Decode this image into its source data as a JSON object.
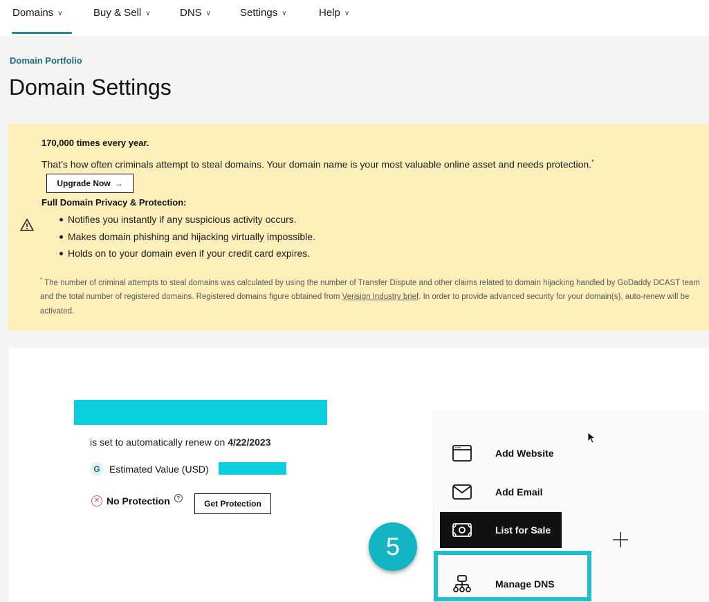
{
  "nav": {
    "items": [
      {
        "label": "Domains"
      },
      {
        "label": "Buy & Sell"
      },
      {
        "label": "DNS"
      },
      {
        "label": "Settings"
      },
      {
        "label": "Help"
      }
    ]
  },
  "breadcrumb": "Domain Portfolio",
  "page_title": "Domain Settings",
  "banner": {
    "headline": "170,000 times every year.",
    "body": "That’s how often criminals attempt to steal domains. Your domain name is your most valuable online asset and needs protection.",
    "body_mark": "*",
    "upgrade_label": "Upgrade Now",
    "features_title": "Full Domain Privacy & Protection:",
    "features": [
      "Notifies you instantly if any suspicious activity occurs.",
      "Makes domain phishing and hijacking virtually impossible.",
      "Holds on to your domain even if your credit card expires."
    ],
    "footnote_mark": "*",
    "footnote_pre": " The number of criminal attempts to steal domains was calculated by using the number of Transfer Dispute and other claims related to domain hijacking handled by GoDaddy DCAST team and the total number of registered domains. Registered domains figure obtained from ",
    "footnote_link": "Verisign Industry brief",
    "footnote_post": ". In order to provide advanced security for your domain(s), auto-renew will be activated."
  },
  "domain": {
    "renew_prefix": "is set to automatically renew on ",
    "renew_date": "4/22/2023",
    "value_badge": "G",
    "estimated_value_label": "Estimated Value (USD)",
    "protection_status": "No Protection",
    "get_protection_label": "Get Protection"
  },
  "actions": [
    {
      "label": "Add Website",
      "icon": "browser-window-icon"
    },
    {
      "label": "Add Email",
      "icon": "envelope-icon"
    },
    {
      "label": "List for Sale",
      "icon": "cash-icon"
    },
    {
      "label": "Manage DNS",
      "icon": "sitemap-icon"
    }
  ],
  "step_badge": "5",
  "colors": {
    "accent": "#1b8b97",
    "banner_bg": "#fcefba",
    "highlight": "#1fc0c9",
    "redaction": "#08cedd"
  }
}
